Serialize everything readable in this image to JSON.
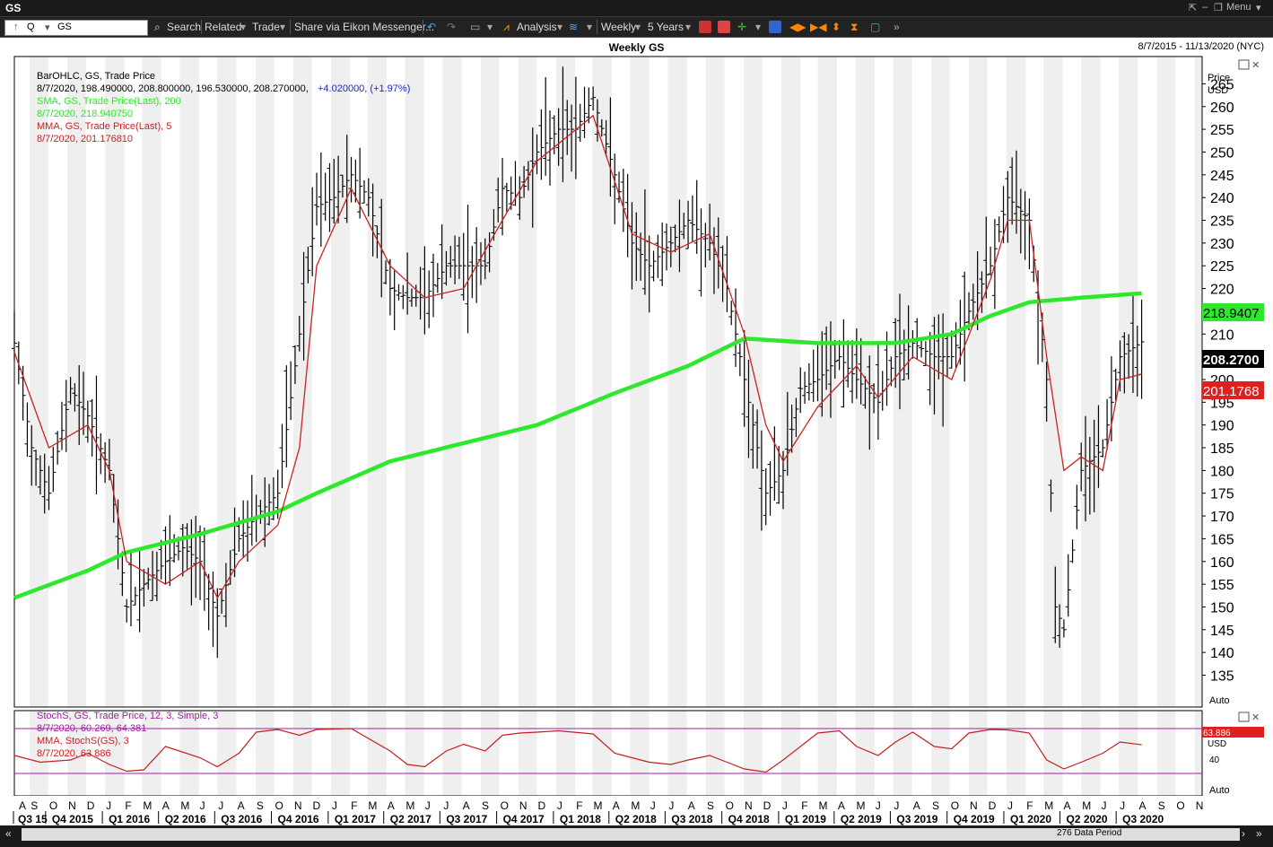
{
  "window": {
    "ticker": "GS",
    "menu_label": "Menu"
  },
  "toolbar": {
    "symbol_prefix": "Q",
    "symbol_value": "GS",
    "search_label": "Search",
    "related_label": "Related",
    "trade_label": "Trade",
    "share_label": "Share via Eikon Messenger...",
    "analysis_label": "Analysis",
    "interval_label": "Weekly",
    "range_label": "5 Years"
  },
  "chart": {
    "title": "Weekly GS",
    "date_range": "8/7/2015 - 11/13/2020 (NYC)",
    "legend": {
      "line1": "BarOHLC, GS, Trade Price",
      "line2_values": "8/7/2020, 198.490000, 208.800000, 196.530000, 208.270000,",
      "line2_change": "+4.020000, (+1.97%)",
      "sma_label": "SMA, GS, Trade Price(Last), 200",
      "sma_value": "8/7/2020, 218.940750",
      "mma_label": "MMA, GS, Trade Price(Last), 5",
      "mma_value": "8/7/2020, 201.176810"
    },
    "axis": {
      "title": "Price",
      "unit": "USD",
      "auto_label": "Auto"
    },
    "badges": {
      "sma": "218.9407",
      "last": "208.2700",
      "mma": "201.1768"
    },
    "colors": {
      "sma": "#2de82d",
      "mma": "#cc2222",
      "bars": "#000000",
      "stoch": "#ff4444",
      "bands": "#a020a0",
      "badge_last": "#000000"
    }
  },
  "stoch_panel": {
    "legend": {
      "line1": "StochS, GS, Trade Price, 12, 3, Simple, 3",
      "line2": "8/7/2020, 60.269, 64.381",
      "line3": "MMA, StochS(GS), 3",
      "line4": "8/7/2020, 63.886"
    },
    "axis_unit": "USD",
    "badge": "63.886",
    "tick": "40",
    "auto_label": "Auto"
  },
  "xaxis": {
    "months": [
      "A",
      "S",
      "O",
      "N",
      "D",
      "J",
      "F",
      "M",
      "A",
      "M",
      "J",
      "J",
      "A",
      "S",
      "O",
      "N",
      "D",
      "J",
      "F",
      "M",
      "A",
      "M",
      "J",
      "J",
      "A",
      "S",
      "O",
      "N",
      "D",
      "J",
      "F",
      "M",
      "A",
      "M",
      "J",
      "J",
      "A",
      "S",
      "O",
      "N",
      "D",
      "J",
      "F",
      "M",
      "A",
      "M",
      "J",
      "J",
      "A",
      "S",
      "O",
      "N",
      "D",
      "J",
      "F",
      "M",
      "A",
      "M",
      "J",
      "J",
      "A",
      "S",
      "O",
      "N",
      "D",
      "J",
      "F",
      "M",
      "A",
      "M",
      "J",
      "J",
      "A",
      "S",
      "O",
      "N"
    ],
    "quarters": [
      "Q3 15",
      "Q4 2015",
      "Q1 2016",
      "Q2 2016",
      "Q3 2016",
      "Q4 2016",
      "Q1 2017",
      "Q2 2017",
      "Q3 2017",
      "Q4 2017",
      "Q1 2018",
      "Q2 2018",
      "Q3 2018",
      "Q4 2018",
      "Q1 2019",
      "Q2 2019",
      "Q3 2019",
      "Q4 2019",
      "Q1 2020",
      "Q2 2020",
      "Q3 2020"
    ]
  },
  "status": {
    "period_label": "276 Data Period"
  },
  "chart_data": {
    "type": "line",
    "title": "Weekly GS",
    "ylabel": "Price USD",
    "ylim": [
      128,
      271
    ],
    "yticks": [
      135,
      140,
      145,
      150,
      155,
      160,
      165,
      170,
      175,
      180,
      185,
      190,
      195,
      200,
      205,
      210,
      215,
      220,
      225,
      230,
      235,
      240,
      245,
      250,
      255,
      260,
      265
    ],
    "x_start": "2015-08-07",
    "x_end": "2020-11-13",
    "series": [
      {
        "name": "BarOHLC, GS, Trade Price",
        "kind": "ohlc",
        "points": [
          [
            "2015-08-07",
            208
          ],
          [
            "2015-09-04",
            185
          ],
          [
            "2015-10-02",
            175
          ],
          [
            "2015-11-06",
            198
          ],
          [
            "2015-12-04",
            192
          ],
          [
            "2016-01-08",
            180
          ],
          [
            "2016-02-05",
            150
          ],
          [
            "2016-03-04",
            155
          ],
          [
            "2016-04-08",
            160
          ],
          [
            "2016-05-06",
            163
          ],
          [
            "2016-06-03",
            160
          ],
          [
            "2016-07-01",
            148
          ],
          [
            "2016-08-05",
            165
          ],
          [
            "2016-09-02",
            170
          ],
          [
            "2016-10-07",
            175
          ],
          [
            "2016-11-11",
            210
          ],
          [
            "2016-12-09",
            238
          ],
          [
            "2017-01-06",
            240
          ],
          [
            "2017-02-03",
            245
          ],
          [
            "2017-03-03",
            240
          ],
          [
            "2017-04-07",
            220
          ],
          [
            "2017-05-05",
            218
          ],
          [
            "2017-06-02",
            218
          ],
          [
            "2017-07-07",
            225
          ],
          [
            "2017-08-04",
            225
          ],
          [
            "2017-09-08",
            225
          ],
          [
            "2017-10-06",
            242
          ],
          [
            "2017-11-03",
            240
          ],
          [
            "2017-12-01",
            250
          ],
          [
            "2018-01-05",
            255
          ],
          [
            "2018-02-02",
            255
          ],
          [
            "2018-03-02",
            262
          ],
          [
            "2018-04-06",
            245
          ],
          [
            "2018-05-04",
            230
          ],
          [
            "2018-06-01",
            225
          ],
          [
            "2018-07-06",
            230
          ],
          [
            "2018-08-03",
            235
          ],
          [
            "2018-09-07",
            230
          ],
          [
            "2018-10-05",
            220
          ],
          [
            "2018-11-02",
            200
          ],
          [
            "2018-12-07",
            175
          ],
          [
            "2019-01-04",
            180
          ],
          [
            "2019-02-01",
            198
          ],
          [
            "2019-03-01",
            200
          ],
          [
            "2019-04-05",
            205
          ],
          [
            "2019-05-03",
            200
          ],
          [
            "2019-06-07",
            195
          ],
          [
            "2019-07-05",
            205
          ],
          [
            "2019-08-02",
            208
          ],
          [
            "2019-09-06",
            205
          ],
          [
            "2019-10-04",
            205
          ],
          [
            "2019-11-01",
            215
          ],
          [
            "2019-12-06",
            225
          ],
          [
            "2020-01-03",
            240
          ],
          [
            "2020-02-07",
            235
          ],
          [
            "2020-03-06",
            200
          ],
          [
            "2020-03-20",
            150
          ],
          [
            "2020-04-03",
            145
          ],
          [
            "2020-05-01",
            180
          ],
          [
            "2020-06-05",
            185
          ],
          [
            "2020-07-03",
            205
          ],
          [
            "2020-08-07",
            208.27
          ]
        ]
      },
      {
        "name": "SMA, GS, Trade Price(Last), 200",
        "points": [
          [
            "2015-08-07",
            152
          ],
          [
            "2015-12-04",
            158
          ],
          [
            "2016-02-05",
            162
          ],
          [
            "2016-06-03",
            166
          ],
          [
            "2016-10-07",
            171
          ],
          [
            "2016-12-09",
            175
          ],
          [
            "2017-04-07",
            182
          ],
          [
            "2017-08-04",
            186
          ],
          [
            "2017-12-01",
            190
          ],
          [
            "2018-04-06",
            197
          ],
          [
            "2018-08-03",
            203
          ],
          [
            "2018-11-02",
            209
          ],
          [
            "2019-03-01",
            208
          ],
          [
            "2019-07-05",
            208
          ],
          [
            "2019-10-04",
            210
          ],
          [
            "2019-12-06",
            214
          ],
          [
            "2020-02-07",
            217
          ],
          [
            "2020-05-01",
            218
          ],
          [
            "2020-08-07",
            218.94
          ]
        ]
      },
      {
        "name": "MMA, GS, Trade Price(Last), 5",
        "points": [
          [
            "2015-08-07",
            206
          ],
          [
            "2015-10-02",
            185
          ],
          [
            "2015-12-04",
            190
          ],
          [
            "2016-01-08",
            180
          ],
          [
            "2016-02-05",
            160
          ],
          [
            "2016-04-08",
            155
          ],
          [
            "2016-06-03",
            160
          ],
          [
            "2016-07-01",
            152
          ],
          [
            "2016-08-05",
            160
          ],
          [
            "2016-10-07",
            168
          ],
          [
            "2016-11-11",
            185
          ],
          [
            "2016-12-09",
            225
          ],
          [
            "2017-02-03",
            242
          ],
          [
            "2017-04-07",
            225
          ],
          [
            "2017-06-02",
            218
          ],
          [
            "2017-08-04",
            220
          ],
          [
            "2017-10-06",
            235
          ],
          [
            "2017-12-01",
            248
          ],
          [
            "2018-03-02",
            258
          ],
          [
            "2018-05-04",
            232
          ],
          [
            "2018-07-06",
            228
          ],
          [
            "2018-09-07",
            232
          ],
          [
            "2018-11-02",
            210
          ],
          [
            "2018-12-07",
            190
          ],
          [
            "2019-01-04",
            182
          ],
          [
            "2019-03-01",
            194
          ],
          [
            "2019-05-03",
            203
          ],
          [
            "2019-06-07",
            196
          ],
          [
            "2019-08-02",
            205
          ],
          [
            "2019-10-04",
            200
          ],
          [
            "2019-12-06",
            222
          ],
          [
            "2020-01-03",
            235
          ],
          [
            "2020-02-07",
            235
          ],
          [
            "2020-03-06",
            205
          ],
          [
            "2020-04-03",
            180
          ],
          [
            "2020-05-01",
            183
          ],
          [
            "2020-06-05",
            180
          ],
          [
            "2020-07-03",
            200
          ],
          [
            "2020-08-07",
            201.18
          ]
        ]
      }
    ],
    "stoch_series": {
      "name": "StochS, GS, Trade Price, 12, 3, Simple, 3",
      "points": [
        [
          "2015-08-07",
          40
        ],
        [
          "2015-09-18",
          25
        ],
        [
          "2015-11-06",
          30
        ],
        [
          "2015-12-04",
          45
        ],
        [
          "2016-01-08",
          20
        ],
        [
          "2016-02-05",
          5
        ],
        [
          "2016-03-04",
          8
        ],
        [
          "2016-04-08",
          60
        ],
        [
          "2016-06-03",
          35
        ],
        [
          "2016-07-01",
          15
        ],
        [
          "2016-08-05",
          45
        ],
        [
          "2016-09-02",
          92
        ],
        [
          "2016-10-07",
          98
        ],
        [
          "2016-11-11",
          85
        ],
        [
          "2016-12-09",
          98
        ],
        [
          "2017-02-03",
          100
        ],
        [
          "2017-04-07",
          50
        ],
        [
          "2017-05-05",
          20
        ],
        [
          "2017-06-02",
          15
        ],
        [
          "2017-07-07",
          50
        ],
        [
          "2017-08-04",
          65
        ],
        [
          "2017-09-08",
          50
        ],
        [
          "2017-10-06",
          85
        ],
        [
          "2017-11-03",
          90
        ],
        [
          "2017-12-01",
          92
        ],
        [
          "2018-01-05",
          95
        ],
        [
          "2018-03-02",
          88
        ],
        [
          "2018-04-06",
          45
        ],
        [
          "2018-05-04",
          35
        ],
        [
          "2018-06-01",
          25
        ],
        [
          "2018-07-06",
          20
        ],
        [
          "2018-08-03",
          30
        ],
        [
          "2018-09-07",
          40
        ],
        [
          "2018-10-05",
          25
        ],
        [
          "2018-11-02",
          10
        ],
        [
          "2018-12-07",
          3
        ],
        [
          "2019-01-04",
          30
        ],
        [
          "2019-02-01",
          60
        ],
        [
          "2019-03-01",
          90
        ],
        [
          "2019-04-05",
          95
        ],
        [
          "2019-05-03",
          60
        ],
        [
          "2019-06-07",
          40
        ],
        [
          "2019-07-05",
          70
        ],
        [
          "2019-08-02",
          92
        ],
        [
          "2019-09-06",
          60
        ],
        [
          "2019-10-04",
          55
        ],
        [
          "2019-11-01",
          90
        ],
        [
          "2019-12-06",
          98
        ],
        [
          "2020-01-03",
          97
        ],
        [
          "2020-02-07",
          90
        ],
        [
          "2020-03-06",
          30
        ],
        [
          "2020-04-03",
          10
        ],
        [
          "2020-05-01",
          25
        ],
        [
          "2020-06-05",
          45
        ],
        [
          "2020-07-03",
          70
        ],
        [
          "2020-08-07",
          63.9
        ]
      ]
    }
  }
}
